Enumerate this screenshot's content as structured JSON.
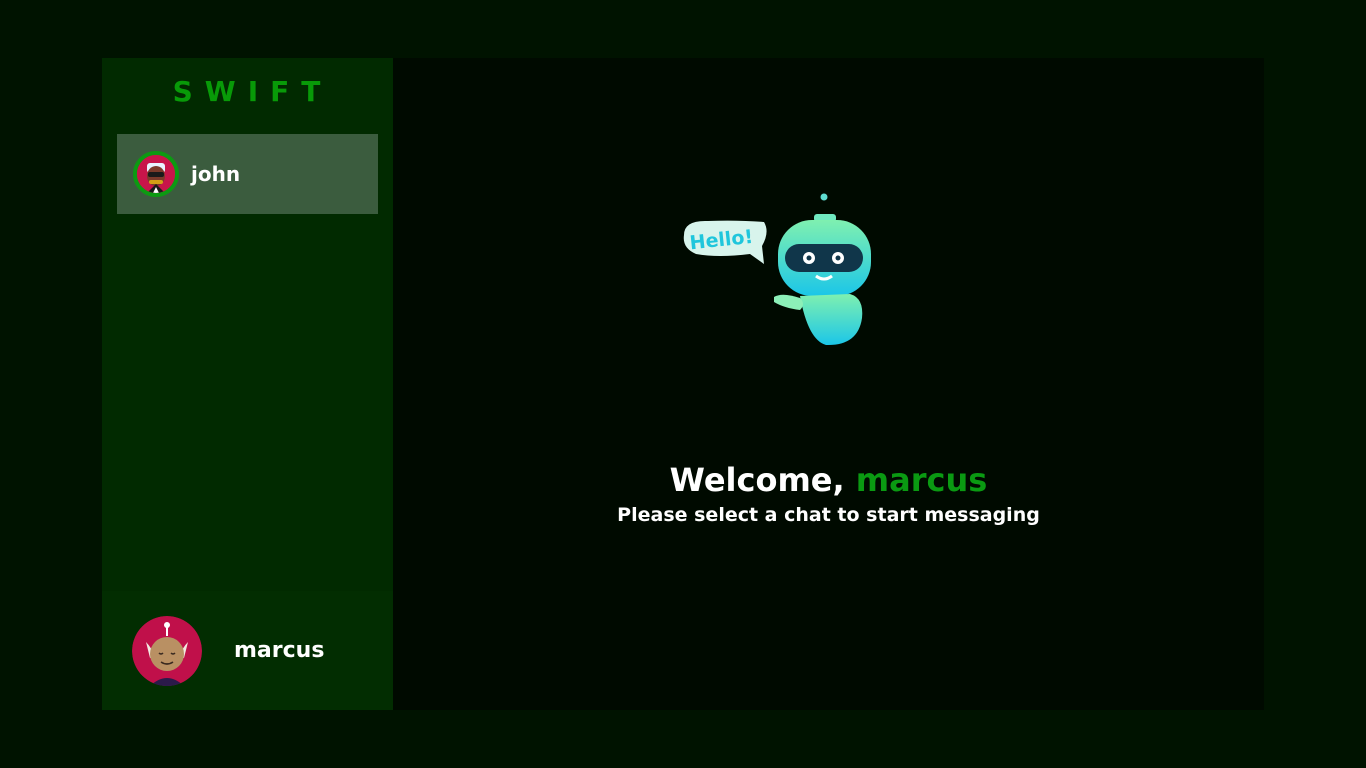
{
  "brand": {
    "name": "SWIFT",
    "color": "#089a08"
  },
  "contacts": [
    {
      "name": "john",
      "avatar": "john-avatar",
      "selected": true
    }
  ],
  "current_user": {
    "name": "marcus",
    "avatar": "marcus-avatar"
  },
  "main": {
    "welcome_prefix": "Welcome,",
    "welcome_name": "marcus",
    "subtitle": "Please select a chat to start messaging",
    "robot_bubble": "Hello!"
  },
  "colors": {
    "background": "#001300",
    "sidebar": "#012a00",
    "selected_contact": "#3b5c3e",
    "main_panel": "#000a00",
    "accent": "#0a9a12"
  }
}
